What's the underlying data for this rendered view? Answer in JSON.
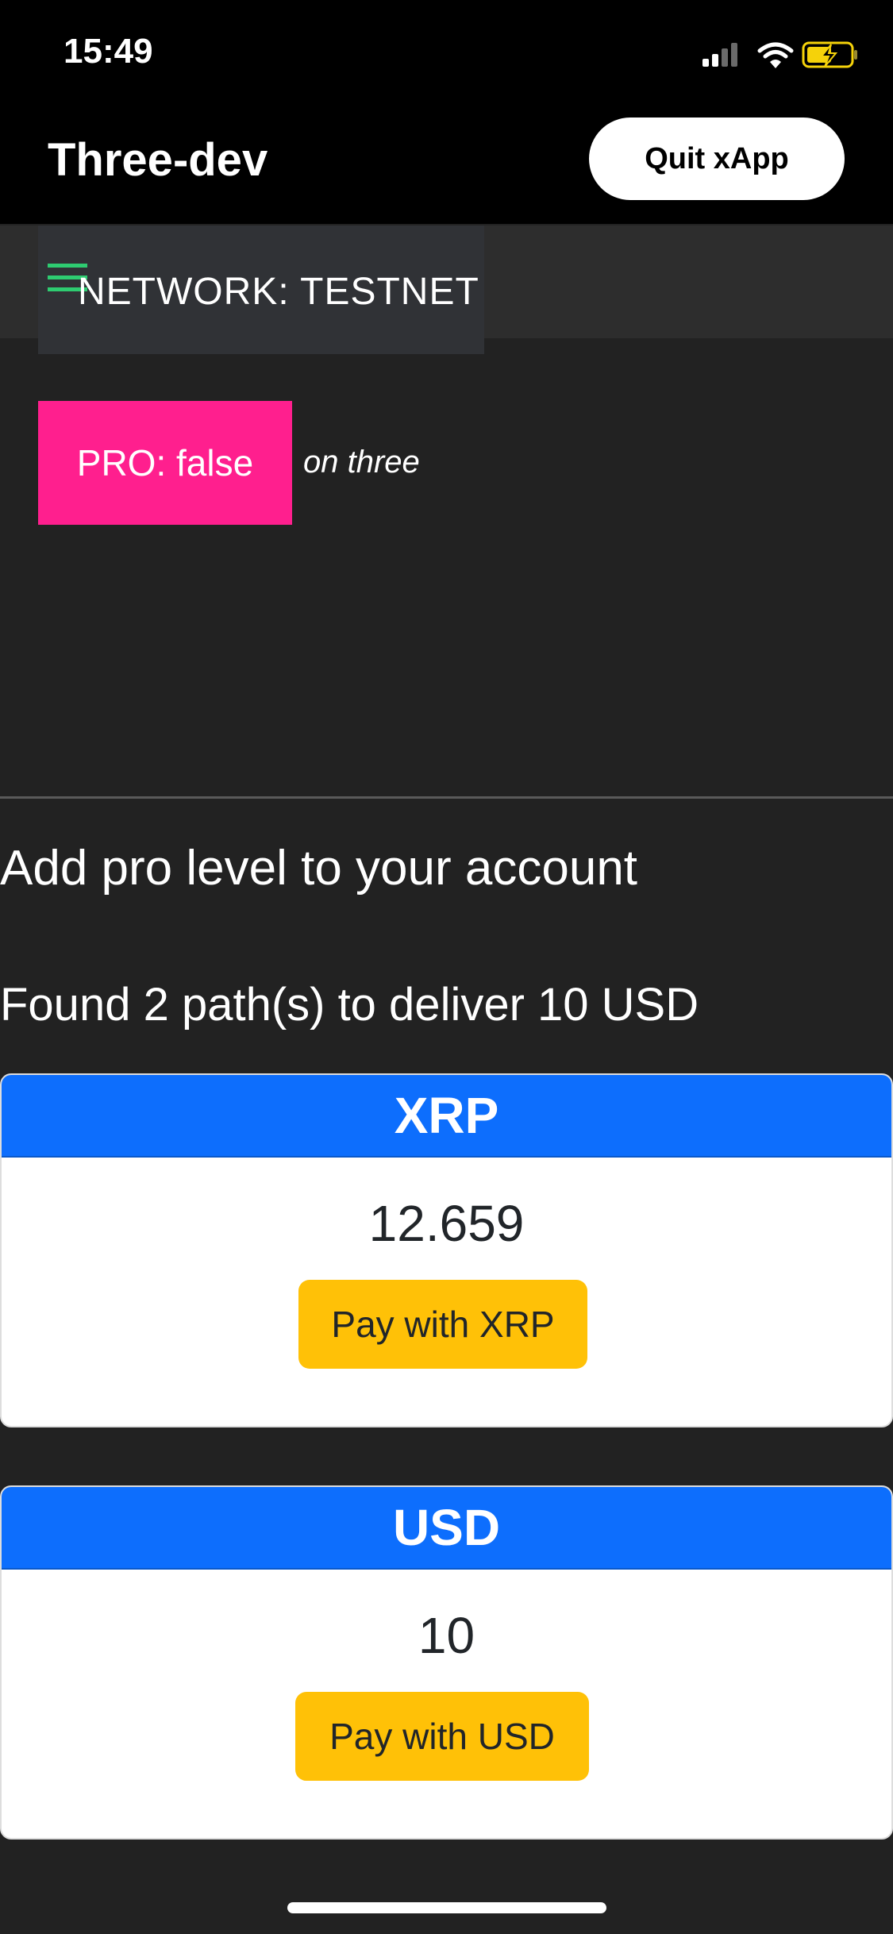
{
  "status_bar": {
    "time": "15:49"
  },
  "header": {
    "title": "Three-dev",
    "quit_label": "Quit xApp"
  },
  "network": {
    "label": "NETWORK: TESTNET"
  },
  "pro": {
    "badge_label": "PRO: false",
    "context": "on three"
  },
  "main": {
    "heading": "Add pro level to your account",
    "paths_text": "Found 2 path(s) to deliver 10 USD"
  },
  "paths": [
    {
      "currency": "XRP",
      "amount": "12.659",
      "button_label": "Pay with XRP"
    },
    {
      "currency": "USD",
      "amount": "10",
      "button_label": "Pay with USD"
    }
  ],
  "colors": {
    "accent_blue": "#0d6efd",
    "pay_yellow": "#ffc107",
    "pro_pink": "#ff1f8e",
    "menu_green": "#2ecc71",
    "battery_yellow": "#f5d20a"
  },
  "icons": [
    "signal-icon",
    "wifi-icon",
    "battery-charging-icon",
    "menu-icon"
  ]
}
